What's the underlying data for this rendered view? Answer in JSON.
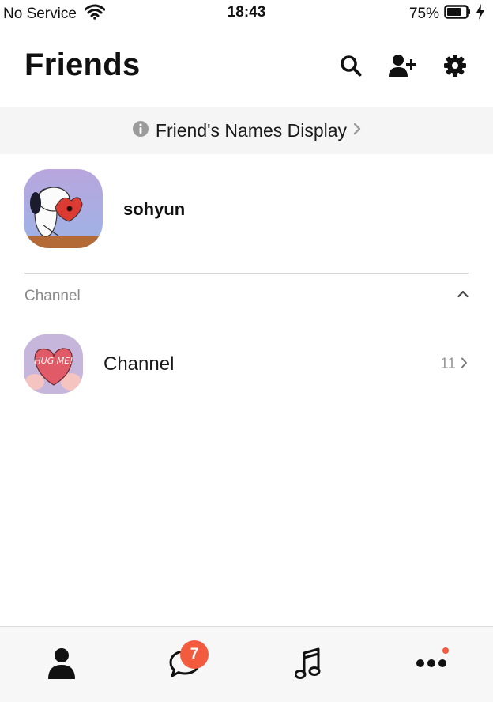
{
  "status_bar": {
    "carrier": "No Service",
    "time": "18:43",
    "battery": "75%",
    "battery_level": 0.75
  },
  "header": {
    "title": "Friends",
    "icons": [
      "search-icon",
      "add-friend-icon",
      "gear-icon"
    ]
  },
  "banner": {
    "text": "Friend's Names Display"
  },
  "profile": {
    "name": "sohyun"
  },
  "section": {
    "label": "Channel",
    "expanded": true
  },
  "channel": {
    "name": "Channel",
    "count": "11",
    "avatar_text": "HUG ME!"
  },
  "tabs": {
    "chats_badge": "7",
    "items": [
      "person-icon",
      "chat-bubble-icon",
      "music-note-icon",
      "more-icon"
    ]
  },
  "colors": {
    "badge": "#f35b3f",
    "banner_bg": "#f5f5f5",
    "tab_bar_bg": "#f7f7f7",
    "secondary_text": "#8a8a8a"
  }
}
